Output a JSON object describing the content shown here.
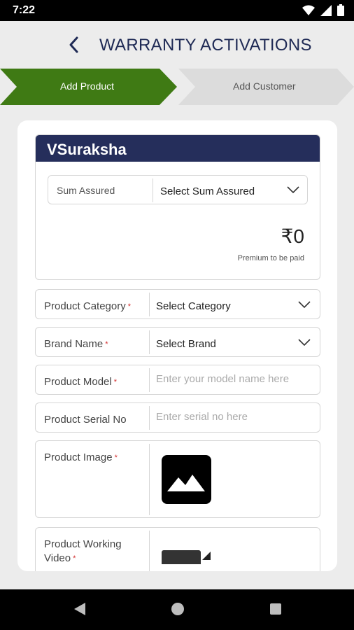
{
  "status_bar": {
    "time": "7:22"
  },
  "header": {
    "title": "WARRANTY ACTIVATIONS"
  },
  "steps": [
    {
      "label": "Add Product",
      "active": true
    },
    {
      "label": "Add Customer",
      "active": false
    }
  ],
  "plan": {
    "name": "VSuraksha",
    "sum_assured_label": "Sum Assured",
    "sum_assured_value": "Select Sum Assured",
    "premium_amount": "₹0",
    "premium_caption": "Premium to be paid"
  },
  "form": {
    "category": {
      "label": "Product Category",
      "required": "*",
      "value": "Select Category"
    },
    "brand": {
      "label": "Brand Name",
      "required": "*",
      "value": "Select Brand"
    },
    "model": {
      "label": "Product Model",
      "required": "*",
      "placeholder": "Enter your model name here"
    },
    "serial": {
      "label": "Product Serial No",
      "placeholder": "Enter serial no here"
    },
    "image": {
      "label": "Product Image",
      "required": "*",
      "icon": "image-placeholder-icon"
    },
    "video": {
      "label_line1": "Product Working",
      "label_line2": "Video",
      "required": "*",
      "icon": "video-placeholder-icon"
    }
  },
  "colors": {
    "brand_navy": "#252e5b",
    "active_step": "#3f7a14",
    "inactive_step": "#dcdcdc",
    "required": "#d32f2f"
  }
}
